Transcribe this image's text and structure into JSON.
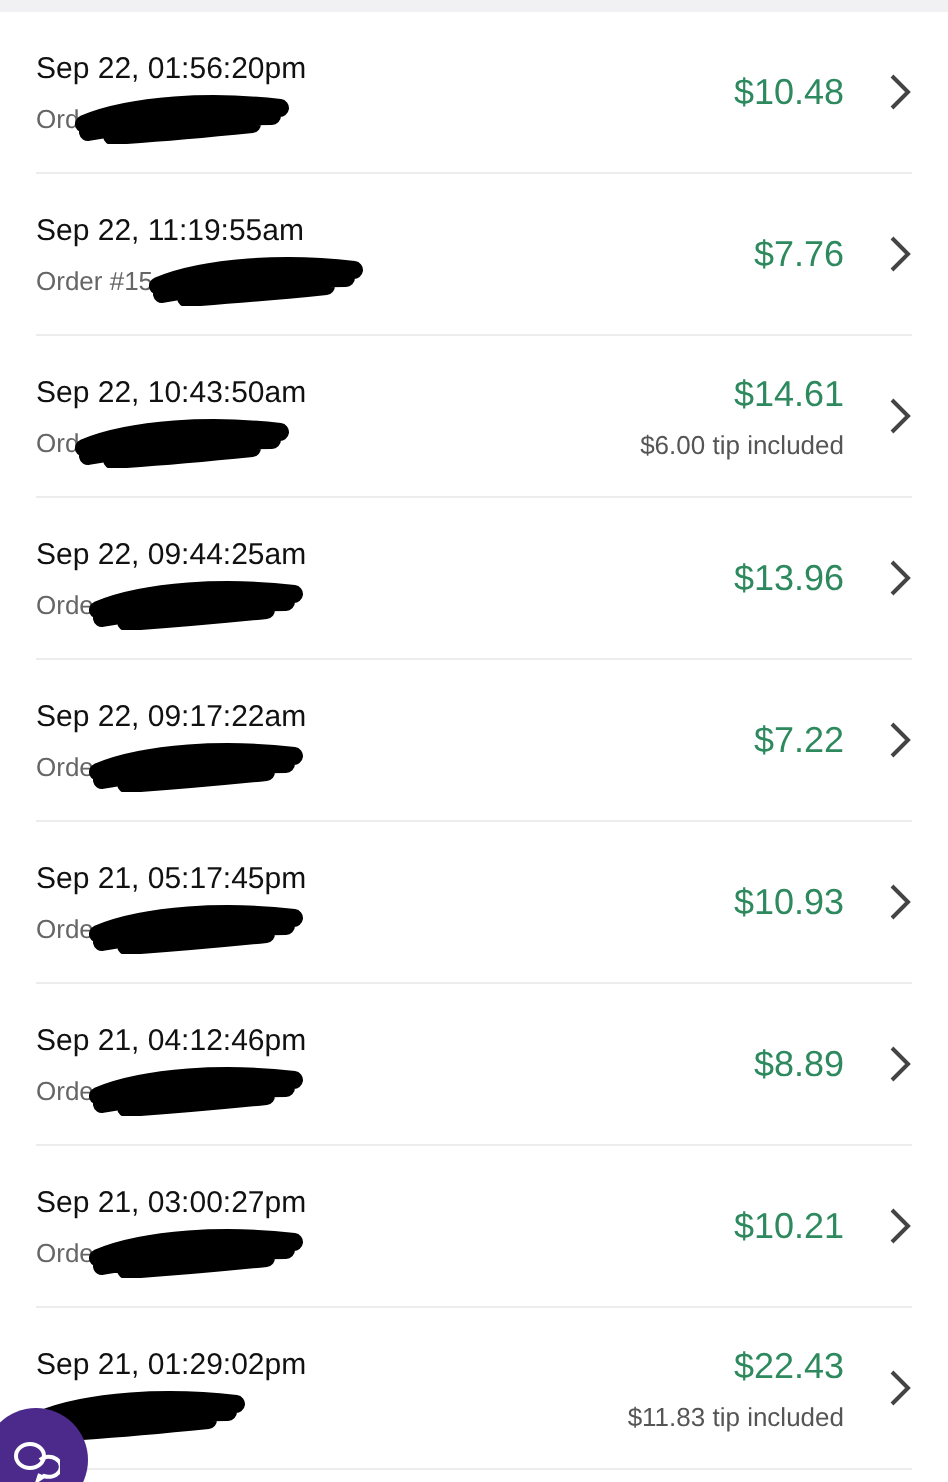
{
  "orders": [
    {
      "time": "Sep 22, 01:56:20pm",
      "order": "Ord",
      "amount": "$10.48"
    },
    {
      "time": "Sep 22, 11:19:55am",
      "order": "Order #15",
      "amount": "$7.76"
    },
    {
      "time": "Sep 22, 10:43:50am",
      "order": "Ord",
      "amount": "$14.61",
      "tip": "$6.00 tip included"
    },
    {
      "time": "Sep 22, 09:44:25am",
      "order": "Orde",
      "amount": "$13.96"
    },
    {
      "time": "Sep 22, 09:17:22am",
      "order": "Orde",
      "amount": "$7.22"
    },
    {
      "time": "Sep 21, 05:17:45pm",
      "order": "Orde",
      "amount": "$10.93"
    },
    {
      "time": "Sep 21, 04:12:46pm",
      "order": "Orde",
      "amount": "$8.89"
    },
    {
      "time": "Sep 21, 03:00:27pm",
      "order": "Orde",
      "amount": "$10.21"
    },
    {
      "time": "Sep 21, 01:29:02pm",
      "amount": "$22.43",
      "tip": "$11.83 tip included"
    }
  ]
}
